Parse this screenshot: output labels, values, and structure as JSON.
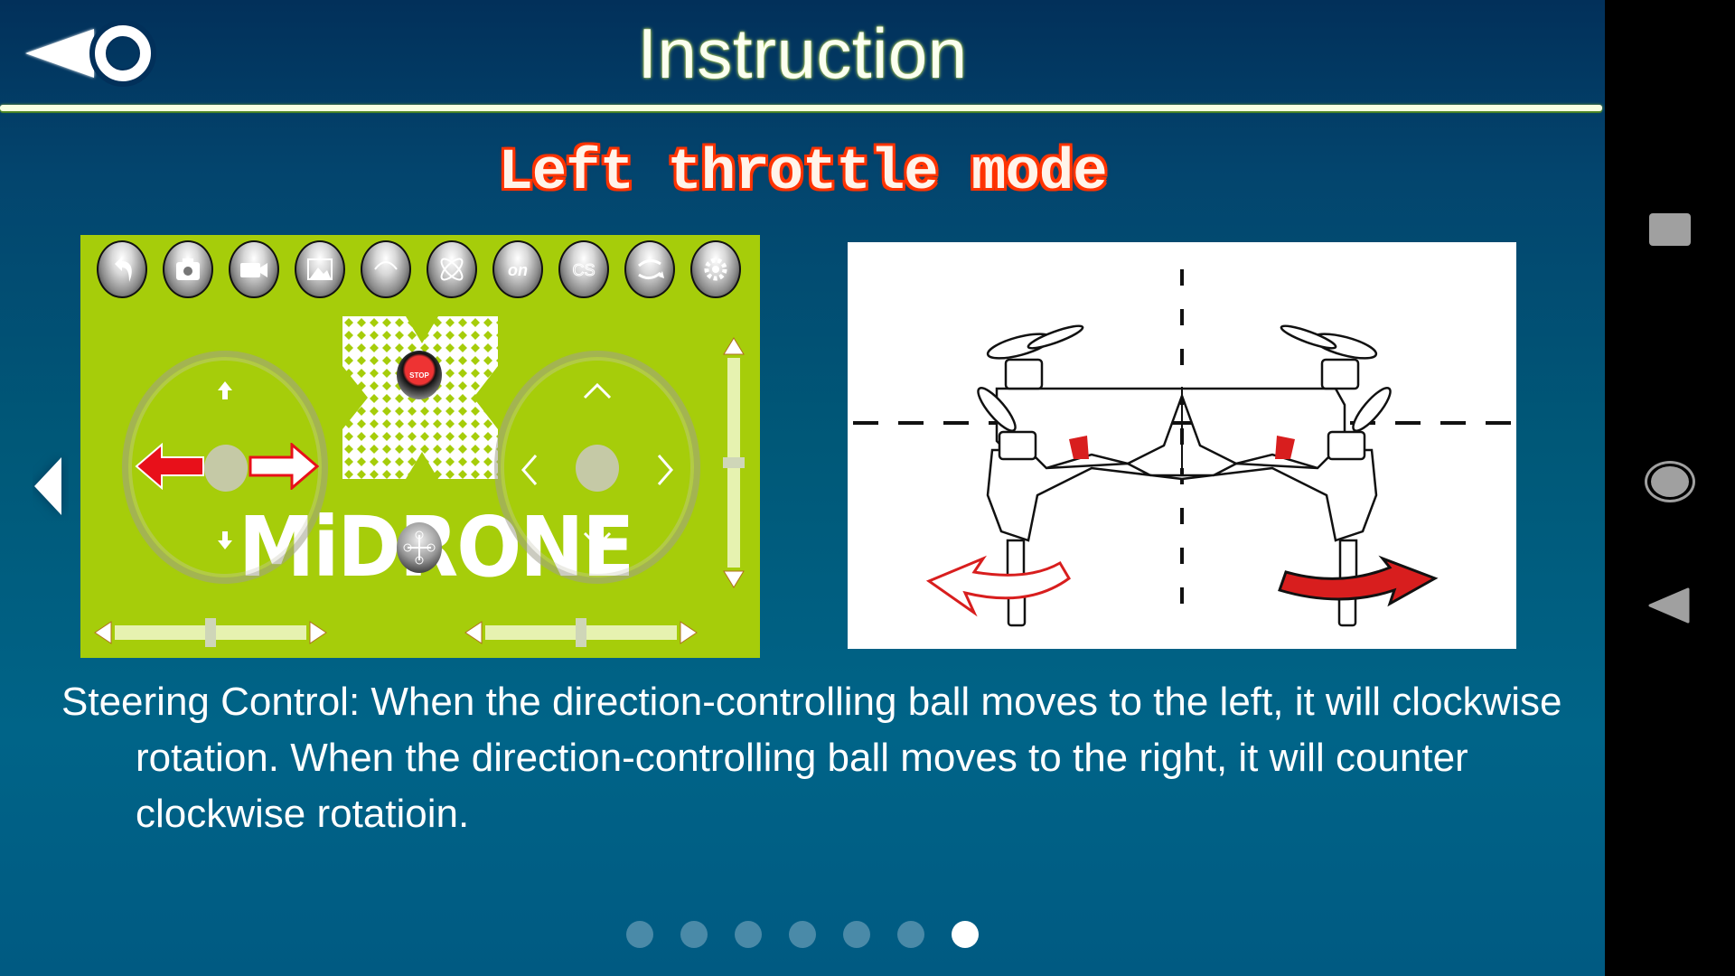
{
  "header": {
    "title": "Instruction",
    "back_icon": "back-triangle-circle-icon"
  },
  "slide": {
    "title": "Left throttle mode",
    "description": "Steering Control: When the direction-controlling ball moves to the left, it will clockwise rotation. When the direction-controlling ball moves to the right, it will counter clockwise rotatioin.",
    "prev_icon": "chevron-left-icon"
  },
  "controller_preview": {
    "logo": "MiDRONE",
    "stop_label": "STOP",
    "toolbar_icons": [
      "return-icon",
      "camera-icon",
      "video-icon",
      "gallery-icon",
      "record-icon",
      "gyro-calibrate-icon",
      "on-icon",
      "headless-icon",
      "flip-icon",
      "settings-gear-icon"
    ],
    "on_label": "on",
    "cs_label": "CS",
    "throttle_trim": 0.5,
    "left_trim": 0.5,
    "right_trim": 0.5
  },
  "illustration": {
    "subject": "quadcopter-yaw-rotation",
    "left_arrow": "counter-clockwise-outline-arrow",
    "right_arrow": "clockwise-filled-arrow"
  },
  "pager": {
    "total": 7,
    "current": 7
  },
  "colors": {
    "panel_green": "#a6cd0a",
    "accent_red": "#ff3300",
    "arrow_red": "#d81e1e",
    "background_blue": "#006186"
  },
  "navbar": {
    "recents_icon": "square-recents-icon",
    "home_icon": "circle-home-icon",
    "back_icon": "triangle-back-icon"
  }
}
